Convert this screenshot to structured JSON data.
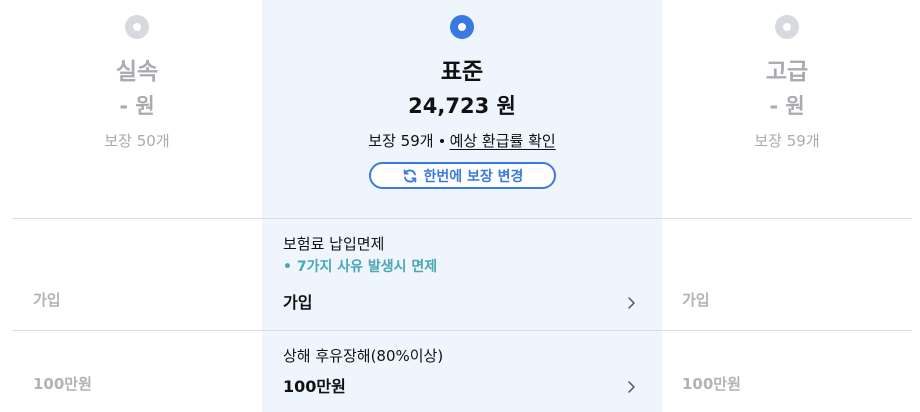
{
  "plans": [
    {
      "name": "실속",
      "price": "- 원",
      "coverage": "보장 50개",
      "selected": false
    },
    {
      "name": "표준",
      "price": "24,723 원",
      "coverage": "보장 59개",
      "refund_link": "예상 환급률 확인",
      "selected": true
    },
    {
      "name": "고급",
      "price": "- 원",
      "coverage": "보장 59개",
      "selected": false
    }
  ],
  "change_button_label": "한번에 보장 변경",
  "rows": [
    {
      "title": "보험료 납입면제",
      "subtitle": "• 7가지 사유 발생시 면제",
      "left_value": "가입",
      "center_value": "가입",
      "right_value": "가입"
    },
    {
      "title": "상해 후유장해(80%이상)",
      "left_value": "100만원",
      "center_value": "100만원",
      "right_value": "100만원"
    }
  ],
  "colors": {
    "accent": "#3a7ae0",
    "teal": "#4aa8b3",
    "muted": "#a8abb0",
    "highlight_bg": "#eef5fc"
  },
  "icons": {
    "radio": "radio-icon",
    "refresh": "refresh-icon",
    "chevron": "chevron-right-icon"
  }
}
